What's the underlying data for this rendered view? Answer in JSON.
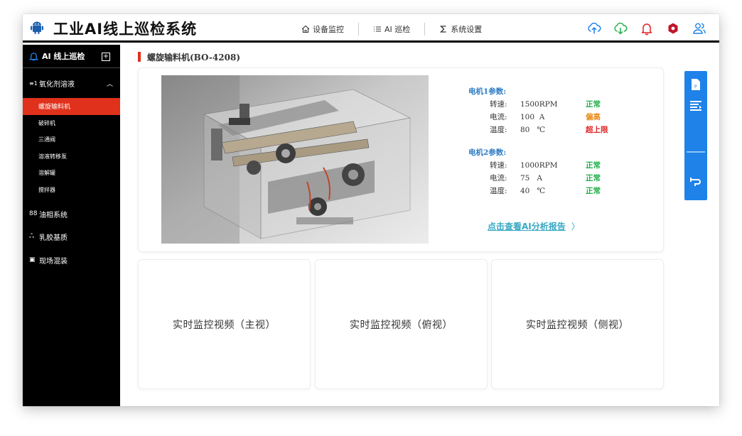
{
  "header": {
    "title": "工业AI线上巡检系统",
    "nav": [
      {
        "label": "设备监控",
        "icon": "home-icon"
      },
      {
        "label": "AI 巡检",
        "icon": "list-icon"
      },
      {
        "label": "系统设置",
        "icon": "sigma-icon"
      }
    ],
    "icons": [
      "upload-cloud-icon",
      "download-cloud-icon",
      "bell-icon",
      "hexagon-icon",
      "users-icon"
    ],
    "colors": {
      "upload": "#1e82e8",
      "download": "#21b04a",
      "bell": "#e02222",
      "hexagon": "#c0142a"
    }
  },
  "sidebar": {
    "title": "AI 线上巡检",
    "add_label": "+",
    "group": {
      "label": "氧化剂溶液",
      "icon_text": "≡1"
    },
    "sub_items": [
      {
        "label": "螺旋输料机",
        "active": true
      },
      {
        "label": "破碎机",
        "active": false
      },
      {
        "label": "三通阀",
        "active": false
      },
      {
        "label": "溶液转移泵",
        "active": false
      },
      {
        "label": "溶解罐",
        "active": false
      },
      {
        "label": "搅拌器",
        "active": false
      }
    ],
    "groups": [
      {
        "label": "油相系统",
        "icon_text": "88"
      },
      {
        "label": "乳胶基质",
        "icon_text": "ஃ"
      },
      {
        "label": "现场混装",
        "icon_text": "▣"
      }
    ]
  },
  "device": {
    "title": "螺旋输料机(BO-4208)",
    "motors": [
      {
        "title": "电机1参数:",
        "rows": [
          {
            "label": "转速:",
            "value": "1500RPM",
            "status": "正常",
            "level": "ok"
          },
          {
            "label": "电流:",
            "value": "100  A",
            "status": "偏高",
            "level": "high"
          },
          {
            "label": "温度:",
            "value": "80   ℃",
            "status": "超上限",
            "level": "over"
          }
        ]
      },
      {
        "title": "电机2参数:",
        "rows": [
          {
            "label": "转速:",
            "value": "1000RPM",
            "status": "正常",
            "level": "ok"
          },
          {
            "label": "电流:",
            "value": "75   A",
            "status": "正常",
            "level": "ok"
          },
          {
            "label": "温度:",
            "value": "40   ℃",
            "status": "正常",
            "level": "ok"
          }
        ]
      }
    ],
    "report_link": "点击查看AI分析报告",
    "report_chevron": "〉"
  },
  "tools": [
    "pdf-file-icon",
    "list-play-icon",
    "pipe-icon"
  ],
  "videos": [
    {
      "label": "实时监控视频（主视）"
    },
    {
      "label": "实时监控视频（俯视）"
    },
    {
      "label": "实时监控视频（侧视）"
    }
  ]
}
